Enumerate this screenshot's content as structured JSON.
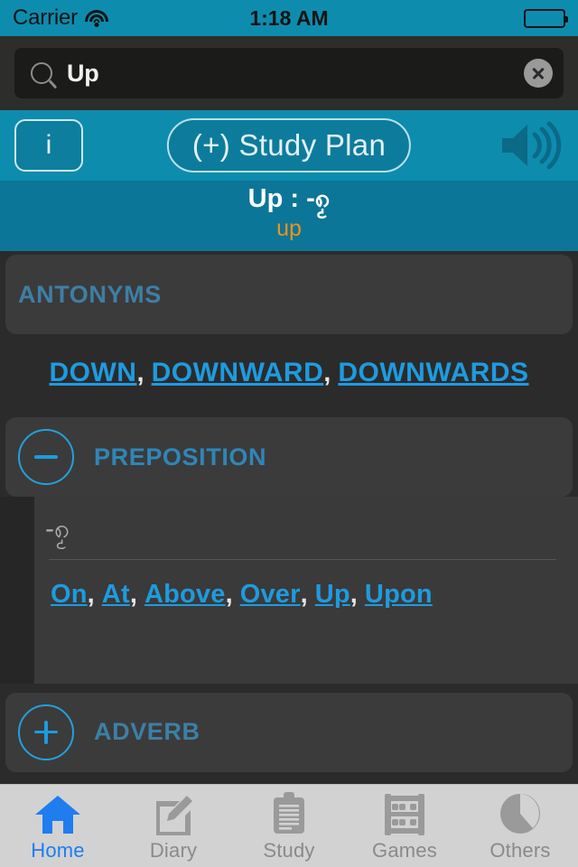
{
  "status": {
    "carrier": "Carrier",
    "wifi_icon": "wifi-icon",
    "time": "1:18 AM",
    "battery_icon": "battery-full-icon"
  },
  "search": {
    "icon": "search-icon",
    "value": "Up",
    "placeholder": "Search",
    "clear_icon": "clear-circle-icon"
  },
  "toolbar": {
    "info_label": "i",
    "study_plan_label": "(+) Study Plan",
    "speaker_icon": "speaker-icon"
  },
  "word": {
    "title": "Up : -၈ၟ",
    "phonetic": "up"
  },
  "sections": [
    {
      "id": "antonyms",
      "label": "ANTONYMS",
      "expanded": true,
      "toggle_icon": "none",
      "links": [
        "DOWN",
        "DOWNWARD",
        "DOWNWARDS"
      ]
    },
    {
      "id": "preposition",
      "label": "PREPOSITION",
      "expanded": true,
      "toggle_icon": "minus-circle-icon",
      "definition": "-၈ၟ",
      "links": [
        "On",
        "At",
        "Above",
        "Over",
        "Up",
        "Upon"
      ]
    },
    {
      "id": "adverb",
      "label": "ADVERB",
      "expanded": false,
      "toggle_icon": "plus-circle-icon",
      "links": []
    }
  ],
  "tabs": [
    {
      "label": "Home",
      "icon": "home-icon",
      "active": true
    },
    {
      "label": "Diary",
      "icon": "note-edit-icon",
      "active": false
    },
    {
      "label": "Study",
      "icon": "clipboard-icon",
      "active": false
    },
    {
      "label": "Games",
      "icon": "abacus-icon",
      "active": false
    },
    {
      "label": "Others",
      "icon": "pie-circle-icon",
      "active": false
    }
  ],
  "colors": {
    "teal_bar": "#0e8cae",
    "teal_header": "#0b7697",
    "accent_link": "#1e9be0",
    "section_label": "#3d7fa6",
    "phonetic_orange": "#f0921b",
    "body_bg": "#2b2b2b",
    "tabbar_bg": "#d2d2d2",
    "tab_active": "#1f7df0"
  }
}
